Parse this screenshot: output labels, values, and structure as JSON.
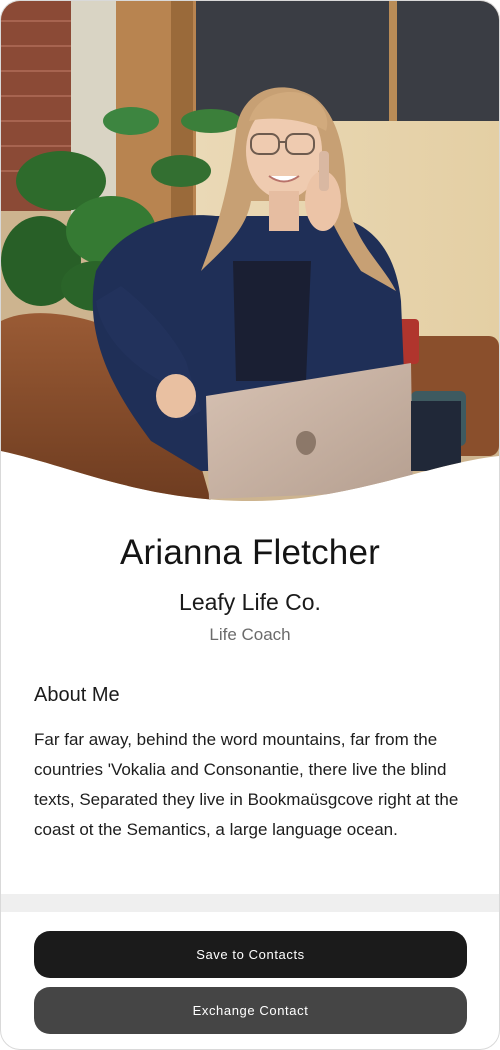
{
  "profile": {
    "name": "Arianna Fletcher",
    "company": "Leafy Life Co.",
    "role": "Life Coach"
  },
  "about": {
    "title": "About Me",
    "text": "Far far away, behind the word mountains, far from the countries 'Vokalia and Consonantie, there live the blind texts, Separated they live in Bookmaüsgcove right at the coast ot the Semantics, a large language ocean."
  },
  "actions": {
    "save_label": "Save to Contacts",
    "exchange_label": "Exchange Contact"
  },
  "colors": {
    "primary_button": "#1b1b1b",
    "secondary_button": "#454545",
    "divider": "#efefef"
  },
  "hero": {
    "icon": "profile-photo"
  }
}
